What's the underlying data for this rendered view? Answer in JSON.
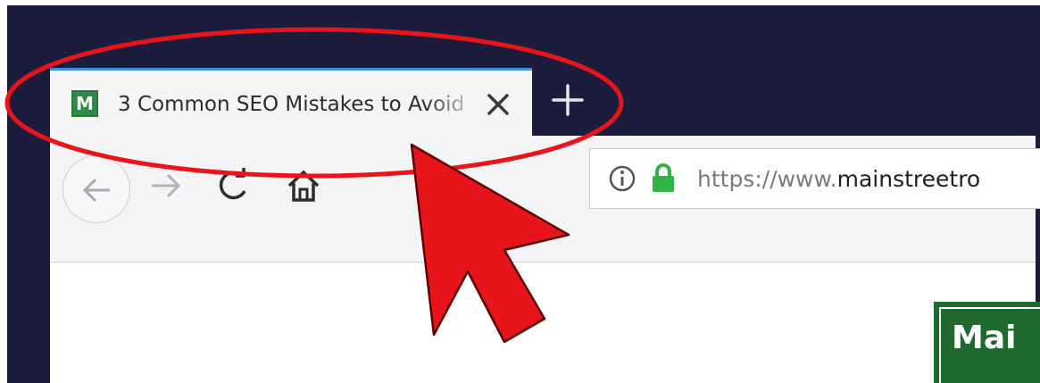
{
  "tab": {
    "favicon_letter": "M",
    "title": "3 Common SEO Mistakes to Avoid",
    "close_icon": "close-icon",
    "new_tab_icon": "plus-icon"
  },
  "toolbar": {
    "back_icon": "arrow-left-icon",
    "forward_icon": "arrow-right-icon",
    "reload_icon": "reload-icon",
    "home_icon": "home-icon"
  },
  "urlbar": {
    "info_icon": "info-icon",
    "lock_icon": "lock-icon",
    "scheme": "https://www.",
    "domain": "mainstreetro"
  },
  "page": {
    "logo_text": "Mai"
  },
  "colors": {
    "titlebar": "#1c1d3d",
    "tab_accent": "#3c8fe6",
    "lock": "#2fb344",
    "favicon": "#2e8b45",
    "annotation": "#e8141b"
  }
}
